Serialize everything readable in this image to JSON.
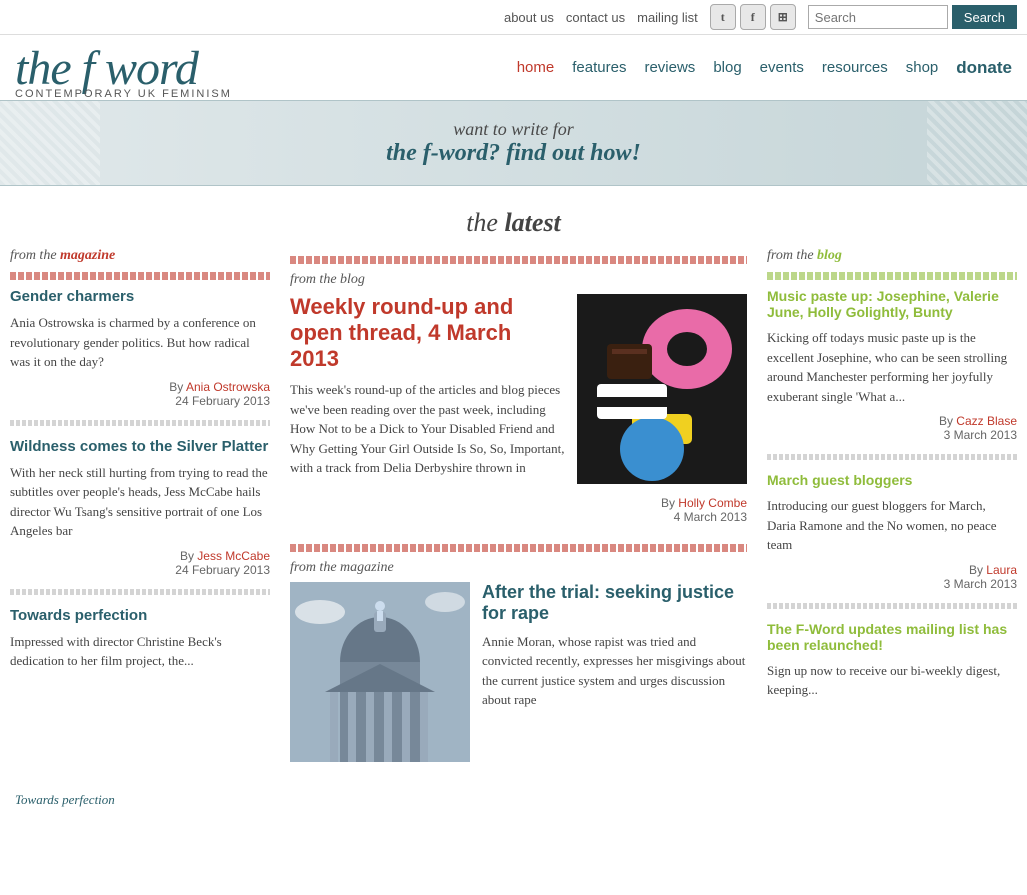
{
  "topnav": {
    "about": "about us",
    "contact": "contact us",
    "mailing": "mailing list",
    "search_placeholder": "Search",
    "search_btn": "Search"
  },
  "social": {
    "twitter": "t",
    "facebook": "f",
    "rss": "~"
  },
  "header": {
    "logo_part1": "the ",
    "logo_f": "f",
    "logo_part2": "word",
    "tagline": "CONTEMPORARY UK FEMINISM",
    "nav": {
      "home": "home",
      "features": "features",
      "reviews": "reviews",
      "blog": "blog",
      "events": "events",
      "resources": "resources",
      "shop": "shop",
      "donate": "donate"
    }
  },
  "promo": {
    "line1": "want to write for",
    "line2_brand": "the f-word",
    "line2_rest": "? find out how!"
  },
  "latest": {
    "heading_pre": "the ",
    "heading_main": "latest"
  },
  "left_column": {
    "from_label": "from the",
    "from_type": "magazine",
    "articles": [
      {
        "title": "Gender charmers",
        "excerpt": "Ania Ostrowska is charmed by a conference on revolutionary gender politics. But how radical was it on the day?",
        "author": "Ania Ostrowska",
        "date": "24 February 2013"
      },
      {
        "title": "Wildness comes to the Silver Platter",
        "excerpt": "With her neck still hurting from trying to read the subtitles over people's heads, Jess McCabe hails director Wu Tsang's sensitive portrait of one Los Angeles bar",
        "author": "Jess McCabe",
        "date": "24 February 2013"
      },
      {
        "title": "Towards perfection",
        "excerpt": "Impressed with director Christine Beck's dedication to her film project, the...",
        "author": "",
        "date": ""
      }
    ]
  },
  "center_column": {
    "article1": {
      "from_label": "from the blog",
      "title": "Weekly round-up and open thread, 4 March 2013",
      "excerpt": "This week's round-up of the articles and blog pieces we've been reading over the past week, including How Not to be a Dick to Your Disabled Friend and Why Getting Your Girl Outside Is So, So, Important, with a track from Delia Derbyshire thrown in",
      "author": "Holly Combe",
      "date": "4 March 2013"
    },
    "article2": {
      "from_label": "from the magazine",
      "title": "After the trial: seeking justice for rape",
      "excerpt": "Annie Moran, whose rapist was tried and convicted recently, expresses her misgivings about the current justice system and urges discussion about rape",
      "author": "",
      "date": ""
    }
  },
  "right_column": {
    "from_label": "from the",
    "from_type": "blog",
    "articles": [
      {
        "title": "Music paste up: Josephine, Valerie June, Holly Golightly, Bunty",
        "excerpt": "Kicking off todays music paste up is the excellent Josephine, who can be seen strolling around Manchester performing her joyfully exuberant single 'What a...",
        "author": "Cazz Blase",
        "date": "3 March 2013"
      },
      {
        "title": "March guest bloggers",
        "excerpt": "Introducing our guest bloggers for March, Daria Ramone and the No women, no peace team",
        "author": "Laura",
        "date": "3 March 2013"
      },
      {
        "title": "The F-Word updates mailing list has been relaunched!",
        "excerpt": "Sign up now to receive our bi-weekly digest, keeping...",
        "author": "",
        "date": ""
      }
    ]
  },
  "footer": {
    "tagline": "Towards perfection"
  }
}
